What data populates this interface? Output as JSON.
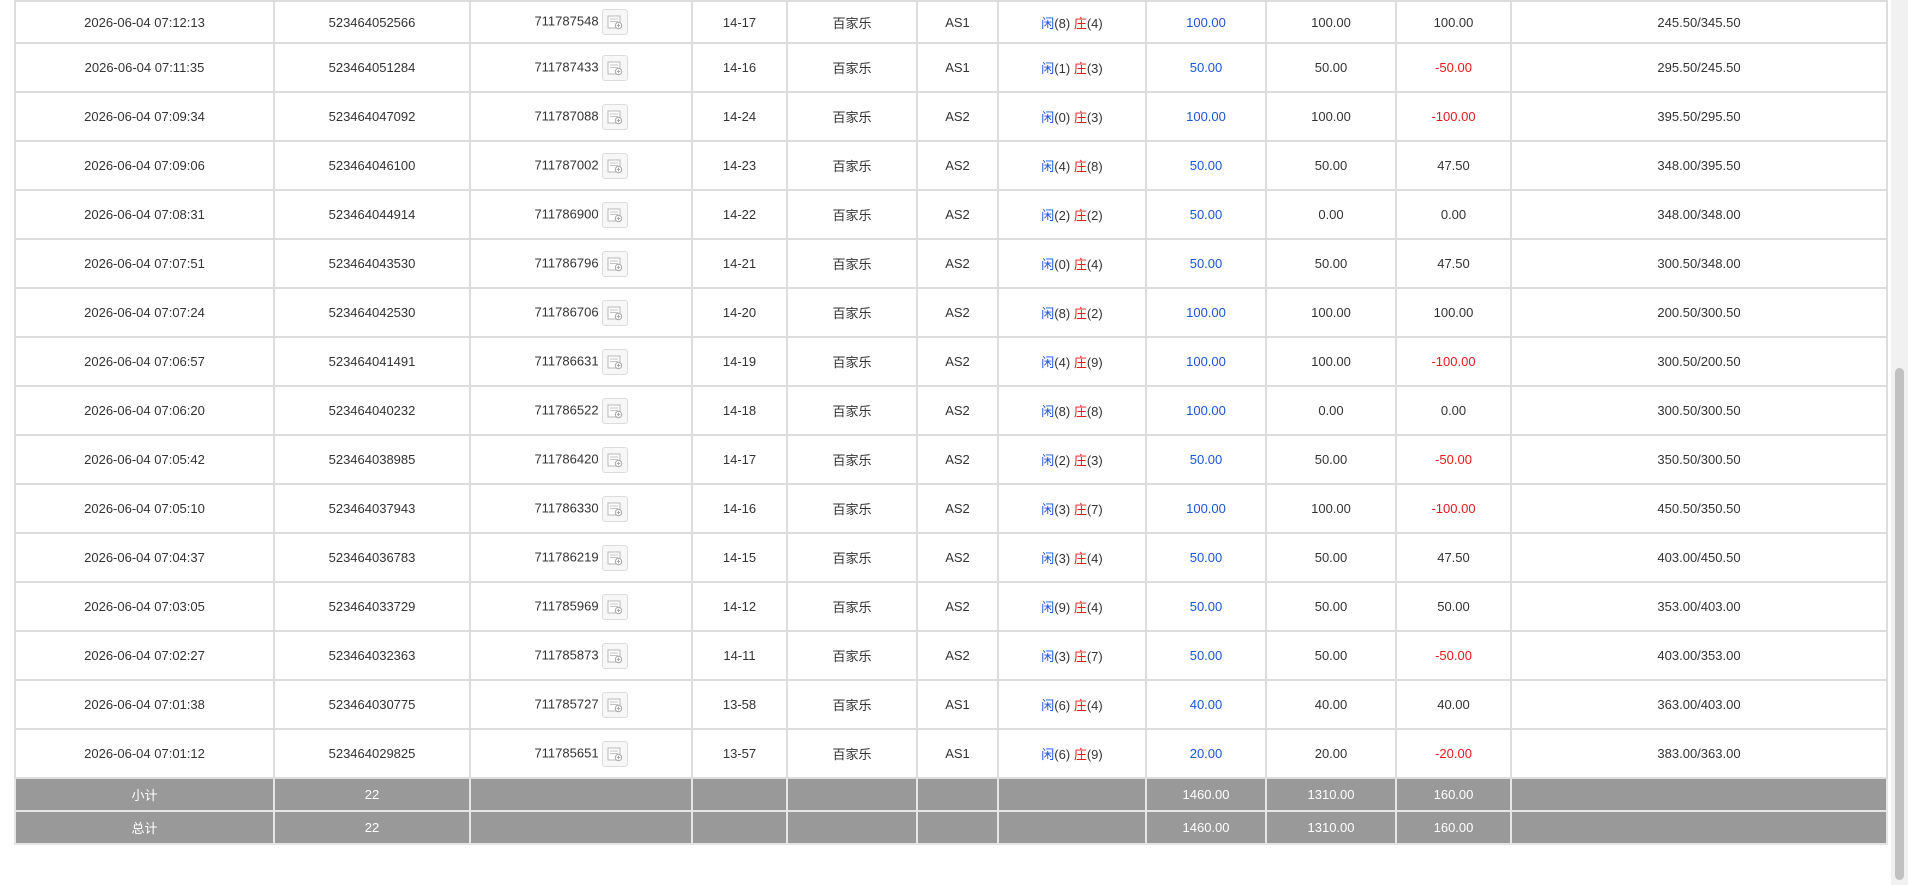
{
  "rows": [
    {
      "time": "2026-06-04 07:12:13",
      "bet_id": "523464052566",
      "round_id": "711787548",
      "shoe": "14-17",
      "game": "百家乐",
      "table": "AS1",
      "player_label": "闲",
      "player_val": "(8)",
      "banker_label": "庄",
      "banker_val": "(4)",
      "bet": "100.00",
      "valid": "100.00",
      "winloss": "100.00",
      "wl_color": "normal",
      "balance": "245.50/345.50"
    },
    {
      "time": "2026-06-04 07:11:35",
      "bet_id": "523464051284",
      "round_id": "711787433",
      "shoe": "14-16",
      "game": "百家乐",
      "table": "AS1",
      "player_label": "闲",
      "player_val": "(1)",
      "banker_label": "庄",
      "banker_val": "(3)",
      "bet": "50.00",
      "valid": "50.00",
      "winloss": "-50.00",
      "wl_color": "red",
      "balance": "295.50/245.50"
    },
    {
      "time": "2026-06-04 07:09:34",
      "bet_id": "523464047092",
      "round_id": "711787088",
      "shoe": "14-24",
      "game": "百家乐",
      "table": "AS2",
      "player_label": "闲",
      "player_val": "(0)",
      "banker_label": "庄",
      "banker_val": "(3)",
      "bet": "100.00",
      "valid": "100.00",
      "winloss": "-100.00",
      "wl_color": "red",
      "balance": "395.50/295.50"
    },
    {
      "time": "2026-06-04 07:09:06",
      "bet_id": "523464046100",
      "round_id": "711787002",
      "shoe": "14-23",
      "game": "百家乐",
      "table": "AS2",
      "player_label": "闲",
      "player_val": "(4)",
      "banker_label": "庄",
      "banker_val": "(8)",
      "bet": "50.00",
      "valid": "50.00",
      "winloss": "47.50",
      "wl_color": "normal",
      "balance": "348.00/395.50"
    },
    {
      "time": "2026-06-04 07:08:31",
      "bet_id": "523464044914",
      "round_id": "711786900",
      "shoe": "14-22",
      "game": "百家乐",
      "table": "AS2",
      "player_label": "闲",
      "player_val": "(2)",
      "banker_label": "庄",
      "banker_val": "(2)",
      "bet": "50.00",
      "valid": "0.00",
      "winloss": "0.00",
      "wl_color": "normal",
      "balance": "348.00/348.00"
    },
    {
      "time": "2026-06-04 07:07:51",
      "bet_id": "523464043530",
      "round_id": "711786796",
      "shoe": "14-21",
      "game": "百家乐",
      "table": "AS2",
      "player_label": "闲",
      "player_val": "(0)",
      "banker_label": "庄",
      "banker_val": "(4)",
      "bet": "50.00",
      "valid": "50.00",
      "winloss": "47.50",
      "wl_color": "normal",
      "balance": "300.50/348.00"
    },
    {
      "time": "2026-06-04 07:07:24",
      "bet_id": "523464042530",
      "round_id": "711786706",
      "shoe": "14-20",
      "game": "百家乐",
      "table": "AS2",
      "player_label": "闲",
      "player_val": "(8)",
      "banker_label": "庄",
      "banker_val": "(2)",
      "bet": "100.00",
      "valid": "100.00",
      "winloss": "100.00",
      "wl_color": "normal",
      "balance": "200.50/300.50"
    },
    {
      "time": "2026-06-04 07:06:57",
      "bet_id": "523464041491",
      "round_id": "711786631",
      "shoe": "14-19",
      "game": "百家乐",
      "table": "AS2",
      "player_label": "闲",
      "player_val": "(4)",
      "banker_label": "庄",
      "banker_val": "(9)",
      "bet": "100.00",
      "valid": "100.00",
      "winloss": "-100.00",
      "wl_color": "red",
      "balance": "300.50/200.50"
    },
    {
      "time": "2026-06-04 07:06:20",
      "bet_id": "523464040232",
      "round_id": "711786522",
      "shoe": "14-18",
      "game": "百家乐",
      "table": "AS2",
      "player_label": "闲",
      "player_val": "(8)",
      "banker_label": "庄",
      "banker_val": "(8)",
      "bet": "100.00",
      "valid": "0.00",
      "winloss": "0.00",
      "wl_color": "normal",
      "balance": "300.50/300.50"
    },
    {
      "time": "2026-06-04 07:05:42",
      "bet_id": "523464038985",
      "round_id": "711786420",
      "shoe": "14-17",
      "game": "百家乐",
      "table": "AS2",
      "player_label": "闲",
      "player_val": "(2)",
      "banker_label": "庄",
      "banker_val": "(3)",
      "bet": "50.00",
      "valid": "50.00",
      "winloss": "-50.00",
      "wl_color": "red",
      "balance": "350.50/300.50"
    },
    {
      "time": "2026-06-04 07:05:10",
      "bet_id": "523464037943",
      "round_id": "711786330",
      "shoe": "14-16",
      "game": "百家乐",
      "table": "AS2",
      "player_label": "闲",
      "player_val": "(3)",
      "banker_label": "庄",
      "banker_val": "(7)",
      "bet": "100.00",
      "valid": "100.00",
      "winloss": "-100.00",
      "wl_color": "red",
      "balance": "450.50/350.50"
    },
    {
      "time": "2026-06-04 07:04:37",
      "bet_id": "523464036783",
      "round_id": "711786219",
      "shoe": "14-15",
      "game": "百家乐",
      "table": "AS2",
      "player_label": "闲",
      "player_val": "(3)",
      "banker_label": "庄",
      "banker_val": "(4)",
      "bet": "50.00",
      "valid": "50.00",
      "winloss": "47.50",
      "wl_color": "normal",
      "balance": "403.00/450.50"
    },
    {
      "time": "2026-06-04 07:03:05",
      "bet_id": "523464033729",
      "round_id": "711785969",
      "shoe": "14-12",
      "game": "百家乐",
      "table": "AS2",
      "player_label": "闲",
      "player_val": "(9)",
      "banker_label": "庄",
      "banker_val": "(4)",
      "bet": "50.00",
      "valid": "50.00",
      "winloss": "50.00",
      "wl_color": "normal",
      "balance": "353.00/403.00"
    },
    {
      "time": "2026-06-04 07:02:27",
      "bet_id": "523464032363",
      "round_id": "711785873",
      "shoe": "14-11",
      "game": "百家乐",
      "table": "AS2",
      "player_label": "闲",
      "player_val": "(3)",
      "banker_label": "庄",
      "banker_val": "(7)",
      "bet": "50.00",
      "valid": "50.00",
      "winloss": "-50.00",
      "wl_color": "red",
      "balance": "403.00/353.00"
    },
    {
      "time": "2026-06-04 07:01:38",
      "bet_id": "523464030775",
      "round_id": "711785727",
      "shoe": "13-58",
      "game": "百家乐",
      "table": "AS1",
      "player_label": "闲",
      "player_val": "(6)",
      "banker_label": "庄",
      "banker_val": "(4)",
      "bet": "40.00",
      "valid": "40.00",
      "winloss": "40.00",
      "wl_color": "normal",
      "balance": "363.00/403.00"
    },
    {
      "time": "2026-06-04 07:01:12",
      "bet_id": "523464029825",
      "round_id": "711785651",
      "shoe": "13-57",
      "game": "百家乐",
      "table": "AS1",
      "player_label": "闲",
      "player_val": "(6)",
      "banker_label": "庄",
      "banker_val": "(9)",
      "bet": "20.00",
      "valid": "20.00",
      "winloss": "-20.00",
      "wl_color": "red",
      "balance": "383.00/363.00"
    }
  ],
  "subtotal": {
    "label": "小计",
    "count": "22",
    "bet": "1460.00",
    "valid": "1310.00",
    "winloss": "160.00"
  },
  "total": {
    "label": "总计",
    "count": "22",
    "bet": "1460.00",
    "valid": "1310.00",
    "winloss": "160.00"
  },
  "icons": {
    "detail": "result-detail-icon"
  },
  "colors": {
    "player": "#1a56d6",
    "banker": "#e31b1b",
    "loss": "#e31b1b",
    "bet": "#1a56d6",
    "summary_bg": "#999999"
  }
}
